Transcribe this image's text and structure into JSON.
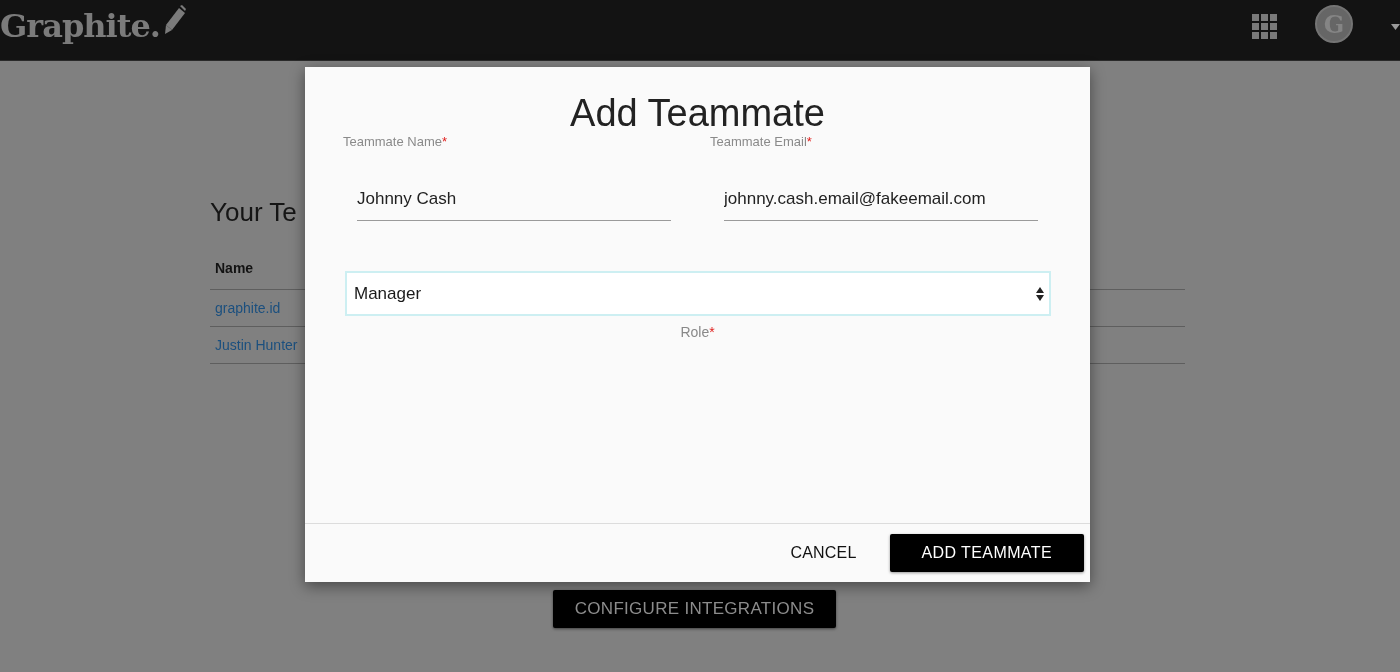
{
  "header": {
    "logo": "Graphite.",
    "avatar_initial": "G"
  },
  "page": {
    "heading": "Your Te",
    "table": {
      "columns": [
        "Name"
      ],
      "rows": [
        [
          "graphite.id"
        ],
        [
          "Justin Hunter"
        ]
      ]
    },
    "button": "CONFIGURE INTEGRATIONS"
  },
  "dialog": {
    "title": "Add Teammate",
    "fields": [
      {
        "label": "Teammate Name",
        "required_mark": "*",
        "value": "Johnny Cash"
      },
      {
        "label": "Teammate Email",
        "required_mark": "*",
        "value": "johnny.cash.email@fakeemail.com"
      }
    ],
    "role": {
      "value": "Manager",
      "label": "Role",
      "required_mark": "*"
    },
    "buttons": [
      {
        "label": "CANCEL",
        "kind": "text"
      },
      {
        "label": "ADD TEAMMATE",
        "kind": "primary"
      }
    ]
  }
}
